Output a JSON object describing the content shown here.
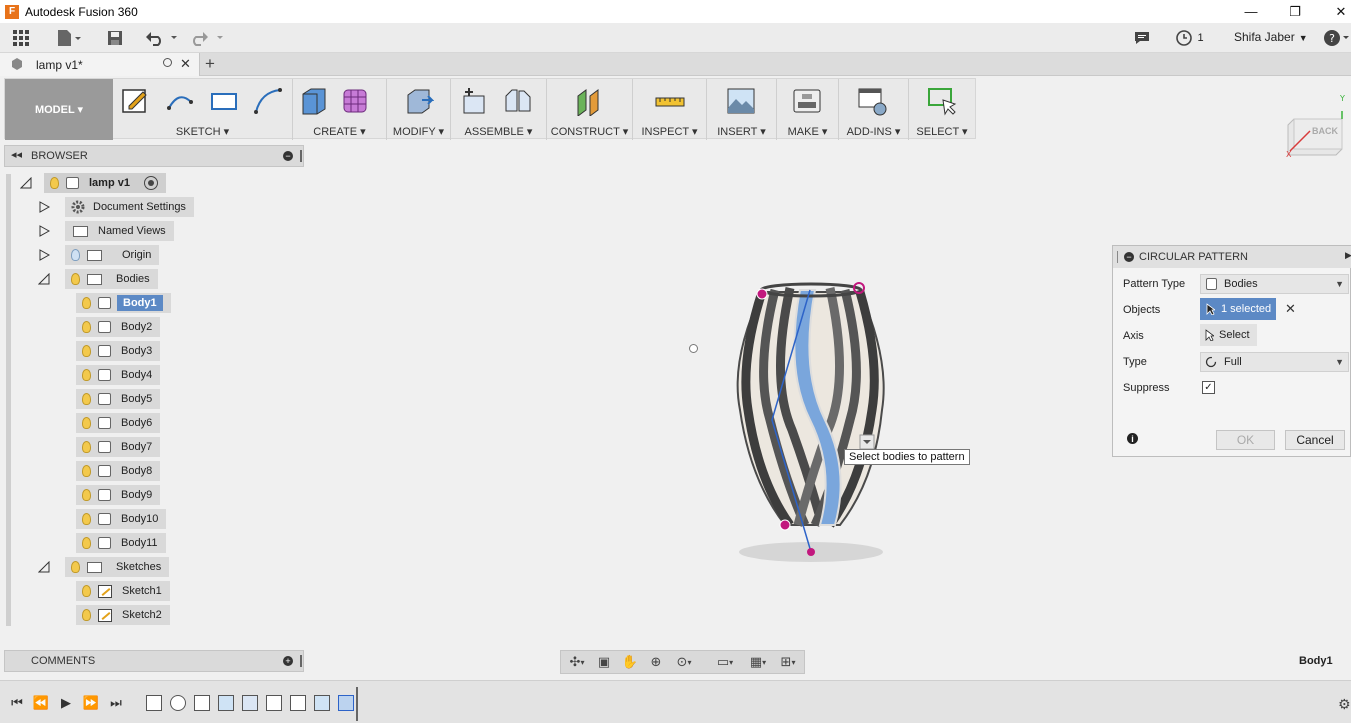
{
  "window": {
    "title": "Autodesk Fusion 360",
    "app_icon": "F"
  },
  "topbar": {
    "user_name": "Shifa Jaber",
    "job_count": "1"
  },
  "tab": {
    "label": "lamp v1*"
  },
  "ribbon": {
    "mode_label": "MODEL ▾",
    "groups": [
      "SKETCH ▾",
      "CREATE ▾",
      "MODIFY ▾",
      "ASSEMBLE ▾",
      "CONSTRUCT ▾",
      "INSPECT ▾",
      "INSERT ▾",
      "MAKE ▾",
      "ADD-INS ▾",
      "SELECT ▾"
    ]
  },
  "browser": {
    "title": "BROWSER",
    "root": "lamp v1",
    "nodes": [
      "Document Settings",
      "Named Views",
      "Origin",
      "Bodies"
    ],
    "bodies": [
      "Body1",
      "Body2",
      "Body3",
      "Body4",
      "Body5",
      "Body6",
      "Body7",
      "Body8",
      "Body9",
      "Body10",
      "Body11"
    ],
    "sketches_label": "Sketches",
    "sketches": [
      "Sketch1",
      "Sketch2"
    ]
  },
  "comments": {
    "title": "COMMENTS"
  },
  "status": {
    "selected": "Body1"
  },
  "viewcube": {
    "face_label": "BACK"
  },
  "dialog": {
    "title": "CIRCULAR PATTERN",
    "labels": {
      "pattern_type": "Pattern Type",
      "objects": "Objects",
      "axis": "Axis",
      "type": "Type",
      "suppress": "Suppress"
    },
    "pattern_type_value": "Bodies",
    "objects_value": "1 selected",
    "axis_value": "Select",
    "type_value": "Full",
    "suppress_checked": "✓",
    "ok_label": "OK",
    "cancel_label": "Cancel"
  },
  "tooltip": {
    "text": "Select bodies to pattern"
  },
  "colors": {
    "accent": "#5c89c5",
    "model_button": "#9a9a9a",
    "selection": "#c2187e"
  }
}
